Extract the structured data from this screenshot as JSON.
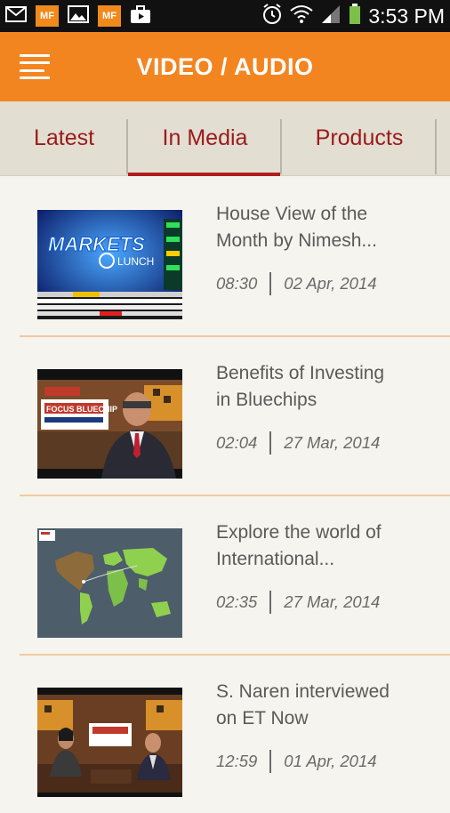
{
  "status_bar": {
    "time": "3:53 PM",
    "left_icons": [
      "mail-icon",
      "mf-app-icon",
      "image-icon",
      "mf-app-icon",
      "briefcase-icon"
    ],
    "mf_label": "MF",
    "right_icons": [
      "alarm-icon",
      "wifi-icon",
      "signal-icon",
      "battery-icon"
    ]
  },
  "header": {
    "title": "VIDEO / AUDIO",
    "menu_icon": "hamburger-menu-icon"
  },
  "tabs": [
    {
      "label": "Latest",
      "active": false
    },
    {
      "label": "In Media",
      "active": true
    },
    {
      "label": "Products",
      "active": false
    }
  ],
  "videos": [
    {
      "title_line1": "House View of the",
      "title_line2": "Month by Nimesh...",
      "duration": "08:30",
      "date": "02 Apr, 2014",
      "thumbnail": "markets-at-lunch-thumbnail"
    },
    {
      "title_line1": "Benefits of Investing",
      "title_line2": "in Bluechips",
      "duration": "02:04",
      "date": "27 Mar, 2014",
      "thumbnail": "bluechip-interview-thumbnail"
    },
    {
      "title_line1": "Explore the world of",
      "title_line2": "International...",
      "duration": "02:35",
      "date": "27 Mar, 2014",
      "thumbnail": "world-map-thumbnail"
    },
    {
      "title_line1": "S. Naren interviewed",
      "title_line2": "on ET Now",
      "duration": "12:59",
      "date": "01 Apr, 2014",
      "thumbnail": "et-now-interview-thumbnail"
    }
  ],
  "colors": {
    "header": "#f28520",
    "tab_text": "#9b1a1a",
    "tab_active_indicator": "#b21e1e",
    "separator": "#f2c9a0",
    "background": "#f5f4ef"
  }
}
